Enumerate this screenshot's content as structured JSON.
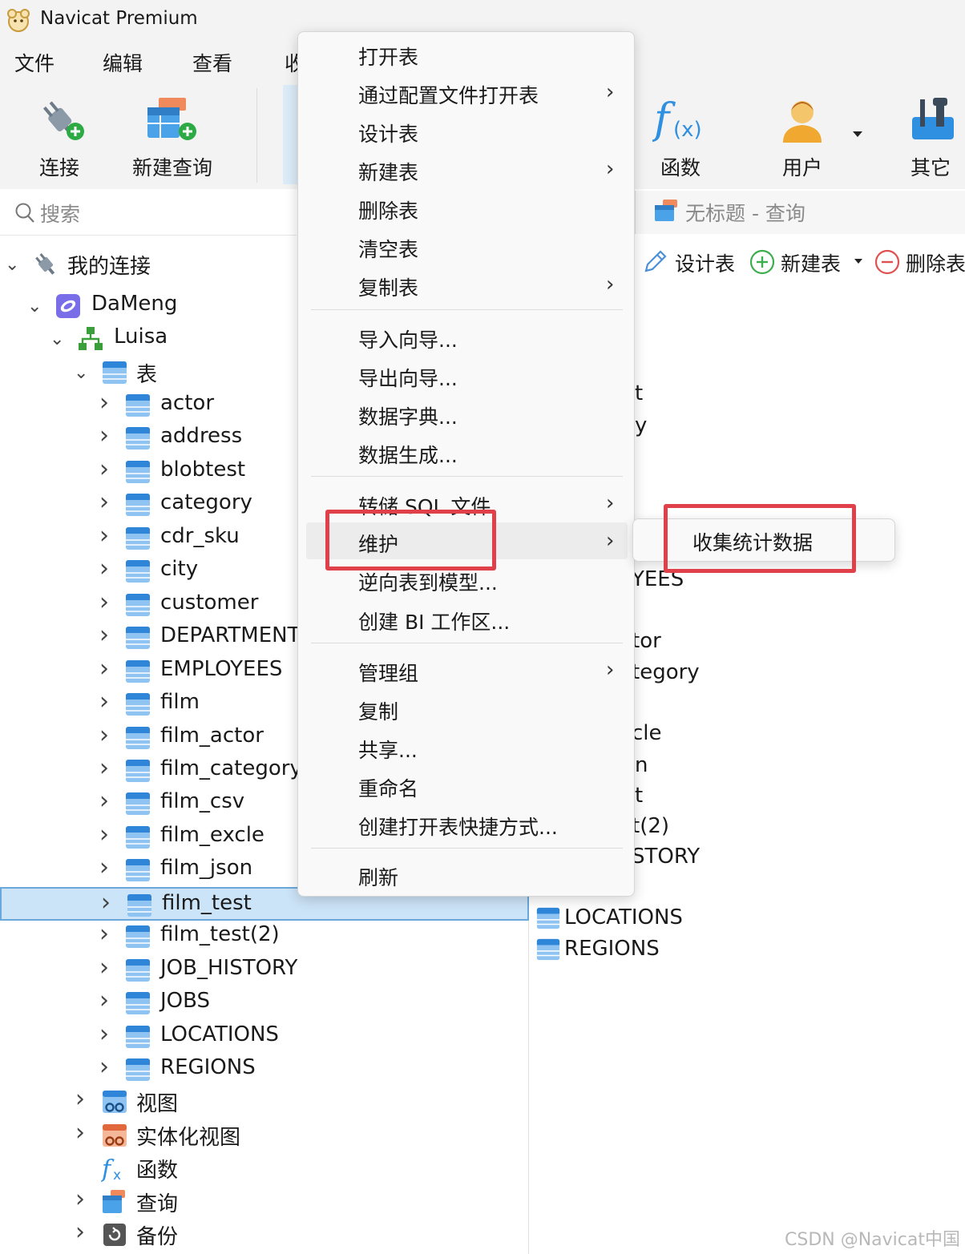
{
  "window": {
    "title": "Navicat Premium"
  },
  "menubar": {
    "items": [
      "文件",
      "编辑",
      "查看",
      "收"
    ]
  },
  "toolbar": {
    "left": [
      {
        "label": "连接",
        "icon": "plug-add-icon"
      },
      {
        "label": "新建查询",
        "icon": "new-query-icon"
      }
    ],
    "right": [
      {
        "label": "函数",
        "icon": "function-icon"
      },
      {
        "label": "用户",
        "icon": "user-icon"
      },
      {
        "label": "其它",
        "icon": "tools-icon"
      }
    ]
  },
  "search": {
    "placeholder": "搜索"
  },
  "tree": {
    "connections_root": "我的连接",
    "connection": "DaMeng",
    "schema": "Luisa",
    "tables_group": "表",
    "tables": [
      "actor",
      "address",
      "blobtest",
      "category",
      "cdr_sku",
      "city",
      "customer",
      "DEPARTMENT",
      "EMPLOYEES",
      "film",
      "film_actor",
      "film_category",
      "film_csv",
      "film_excle",
      "film_json",
      "film_test",
      "film_test(2)",
      "JOB_HISTORY",
      "JOBS",
      "LOCATIONS",
      "REGIONS"
    ],
    "selected_table": "film_test",
    "other_groups": [
      "视图",
      "实体化视图",
      "函数",
      "查询",
      "备份"
    ]
  },
  "right_pane": {
    "tab_title": "无标题 - 查询",
    "object_toolbar": [
      "设计表",
      "新建表",
      "删除表"
    ],
    "partial_items": [
      "t",
      "y",
      "r",
      "YEES",
      "tor",
      "tegory",
      "cle",
      "n",
      "t",
      "t(2)",
      "STORY"
    ],
    "full_items": [
      "LOCATIONS",
      "REGIONS"
    ]
  },
  "context_menu": {
    "groups": [
      [
        {
          "label": "打开表",
          "submenu": false
        },
        {
          "label": "通过配置文件打开表",
          "submenu": true
        },
        {
          "label": "设计表",
          "submenu": false
        },
        {
          "label": "新建表",
          "submenu": true
        },
        {
          "label": "删除表",
          "submenu": false
        },
        {
          "label": "清空表",
          "submenu": false
        },
        {
          "label": "复制表",
          "submenu": true
        }
      ],
      [
        {
          "label": "导入向导...",
          "submenu": false
        },
        {
          "label": "导出向导...",
          "submenu": false
        },
        {
          "label": "数据字典...",
          "submenu": false
        },
        {
          "label": "数据生成...",
          "submenu": false
        }
      ],
      [
        {
          "label": "转储 SQL 文件",
          "submenu": true
        },
        {
          "label": "维护",
          "submenu": true,
          "hovered": true
        },
        {
          "label": "逆向表到模型...",
          "submenu": false
        },
        {
          "label": "创建 BI 工作区...",
          "submenu": false
        }
      ],
      [
        {
          "label": "管理组",
          "submenu": true
        },
        {
          "label": "复制",
          "submenu": false
        },
        {
          "label": "共享...",
          "submenu": false
        },
        {
          "label": "重命名",
          "submenu": false
        },
        {
          "label": "创建打开表快捷方式...",
          "submenu": false
        }
      ],
      [
        {
          "label": "刷新",
          "submenu": false
        }
      ]
    ],
    "arrow_glyph": "›"
  },
  "submenu": {
    "items": [
      "收集统计数据"
    ]
  },
  "highlight_color": "#e0404a",
  "watermark": "CSDN @Navicat中国"
}
